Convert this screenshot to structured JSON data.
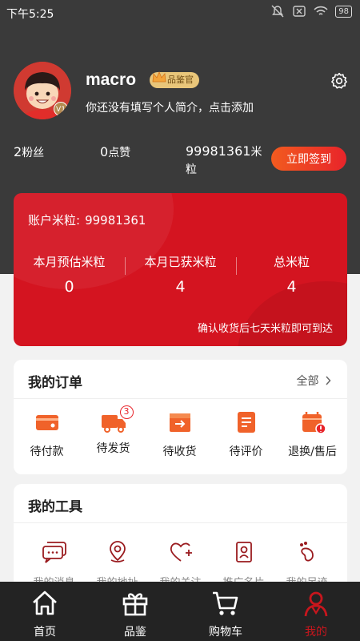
{
  "status_bar": {
    "time": "下午5:25",
    "battery": "98"
  },
  "profile": {
    "username": "macro",
    "rank_badge": "品鉴官",
    "avatar_level": "V1",
    "bio": "你还没有填写个人简介，点击添加"
  },
  "stats": {
    "fans_count": "2",
    "fans_label": "粉丝",
    "likes_count": "0",
    "likes_label": "点赞",
    "points_count": "99981361",
    "points_label": "米粒",
    "signin_label": "立即签到"
  },
  "points_card": {
    "account_label": "账户米粒:",
    "account_value": "99981361",
    "columns": [
      {
        "label": "本月预估米粒",
        "value": "0"
      },
      {
        "label": "本月已获米粒",
        "value": "4"
      },
      {
        "label": "总米粒",
        "value": "4"
      }
    ],
    "note": "确认收货后七天米粒即可到达"
  },
  "orders": {
    "title": "我的订单",
    "more_label": "全部",
    "items": [
      {
        "label": "待付款",
        "icon": "wallet-icon"
      },
      {
        "label": "待发货",
        "icon": "truck-icon",
        "badge": "3"
      },
      {
        "label": "待收货",
        "icon": "box-icon"
      },
      {
        "label": "待评价",
        "icon": "review-icon"
      },
      {
        "label": "退换/售后",
        "icon": "return-icon"
      }
    ]
  },
  "tools": {
    "title": "我的工具",
    "items": [
      {
        "label": "我的消息",
        "icon": "message-icon"
      },
      {
        "label": "我的地址",
        "icon": "location-icon"
      },
      {
        "label": "我的关注",
        "icon": "heart-icon"
      },
      {
        "label": "推广名片",
        "icon": "card-icon"
      },
      {
        "label": "我的足迹",
        "icon": "footprint-icon"
      }
    ]
  },
  "tabbar": {
    "items": [
      {
        "label": "首页",
        "icon": "home-icon"
      },
      {
        "label": "品鉴",
        "icon": "gift-icon"
      },
      {
        "label": "购物车",
        "icon": "cart-icon"
      },
      {
        "label": "我的",
        "icon": "user-icon",
        "active": true
      }
    ]
  },
  "colors": {
    "accent_red": "#d41420",
    "signin_gradient_start": "#f25b1f",
    "header_dark": "#3a3a3a",
    "tabbar_dark": "#232323",
    "icon_orange": "#f0622a"
  }
}
